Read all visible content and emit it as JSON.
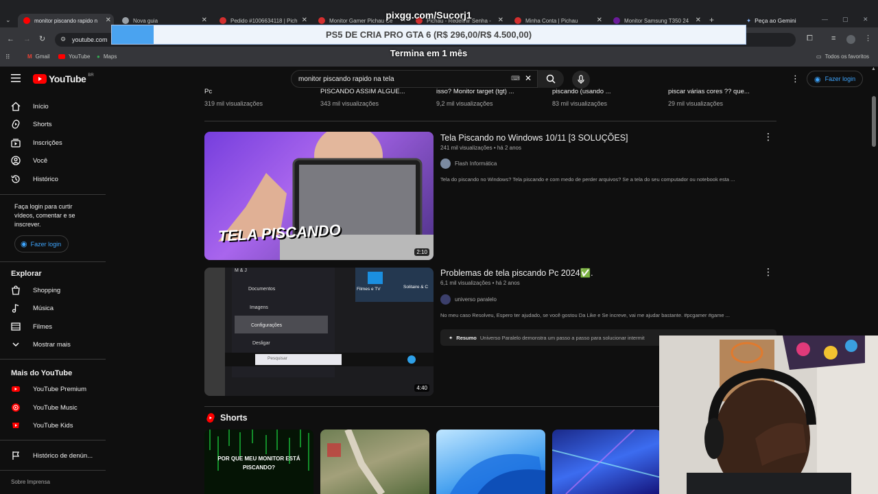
{
  "overlay": {
    "donation_handle": "pixgg.com/Sucorj1",
    "donation_banner": "PS5 DE CRIA PRO GTA 6 (R$ 296,00/R$ 4.500,00)",
    "donation_progress": 0.066,
    "donation_timer": "Termina em 1 mês"
  },
  "browser": {
    "tabs": [
      {
        "title": "monitor piscando rapido n",
        "icon": "youtube-icon",
        "active": true
      },
      {
        "title": "Nova guia",
        "icon": "chrome-icon",
        "active": false
      },
      {
        "title": "Pedido #1006634118 | Pich",
        "icon": "pichau-icon",
        "active": false
      },
      {
        "title": "Monitor Gamer Pichau Ce",
        "icon": "pichau-icon",
        "active": false
      },
      {
        "title": "Pichau - Redefinir Senha -",
        "icon": "pichau-icon",
        "active": false
      },
      {
        "title": "Minha Conta | Pichau",
        "icon": "pichau-icon",
        "active": false
      },
      {
        "title": "Monitor Samsung T350 24",
        "icon": "samsung-icon",
        "active": false
      }
    ],
    "gemini_label": "Peça ao Gemini",
    "url": "youtube.com",
    "google_label": "ogle",
    "bookmarks": [
      "Gmail",
      "YouTube",
      "Maps"
    ],
    "all_bookmarks": "Todos os favoritos"
  },
  "youtube": {
    "logo_text": "YouTube",
    "region": "BR",
    "search_query": "monitor piscando rapido na tela",
    "login_label": "Fazer login",
    "sidebar": {
      "main_items": [
        "Início",
        "Shorts",
        "Inscrições",
        "Você",
        "Histórico"
      ],
      "login_prompt": "Faça login para curtir vídeos, comentar e se inscrever.",
      "login_label": "Fazer login",
      "explore_title": "Explorar",
      "explore_items": [
        "Shopping",
        "Música",
        "Filmes",
        "Mostrar mais"
      ],
      "more_title": "Mais do YouTube",
      "more_items": [
        "YouTube Premium",
        "YouTube Music",
        "YouTube Kids"
      ],
      "report_history": "Histórico de denún...",
      "footer": "Sobre  Imprensa"
    },
    "top_row": [
      {
        "title": "Pc",
        "views": "319 mil visualizações"
      },
      {
        "title": "PISCANDO ASSIM ALGUE...",
        "views": "343 mil visualizações"
      },
      {
        "title": "isso? Monitor target (tgt) ...",
        "views": "9,2 mil visualizações"
      },
      {
        "title": "piscando (usando ...",
        "views": "83 mil visualizações"
      },
      {
        "title": "piscar várias cores ?? que...",
        "views": "29 mil visualizações"
      }
    ],
    "videos": [
      {
        "title": "Tela Piscando no Windows 10/11 [3 SOLUÇÕES]",
        "meta": "241 mil visualizações • há 2 anos",
        "channel": "Flash Informática",
        "description": "Tela do piscando no Windows? Tela piscando e com medo de perder arquivos? Se a tela do seu computador ou notebook esta ...",
        "duration": "2:10",
        "thumb_caption": "TELA PISCANDO"
      },
      {
        "title": "Problemas de tela piscando Pc 2024✅.",
        "meta": "6,1 mil visualizações • há 2 anos",
        "channel": "universo paralelo",
        "description": "No meu caso Resolveu, Espero ter ajudado, se você gostou Da Like e Se increve, vai me ajudar bastante. #pcgamer #game ...",
        "summary_label": "Resumo",
        "summary_text": "Universo Paralelo demonstra um passo a passo para solucionar intermit",
        "duration": "4:40",
        "thumb_menu": [
          "M & J",
          "Documentos",
          "Imagens",
          "Configurações",
          "Desligar"
        ],
        "thumb_tiles": [
          "Filmes e TV",
          "Solitaire & C"
        ],
        "thumb_search": "Pesquisar"
      }
    ],
    "shorts_title": "Shorts",
    "shorts": [
      {
        "caption": "POR QUE MEU MONITOR ESTÁ PISCANDO?"
      }
    ]
  }
}
